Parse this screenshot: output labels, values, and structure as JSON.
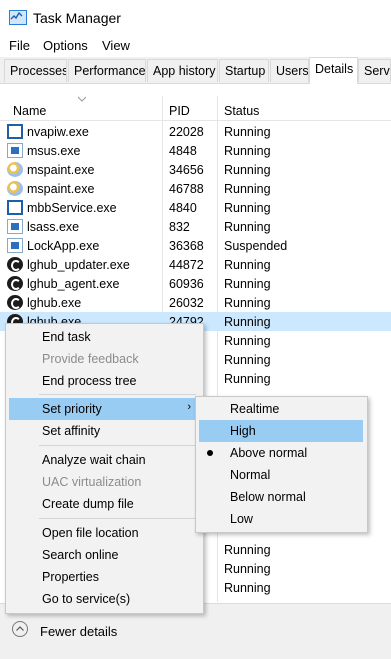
{
  "window": {
    "title": "Task Manager"
  },
  "menu": [
    "File",
    "Options",
    "View"
  ],
  "tabs": [
    "Processes",
    "Performance",
    "App history",
    "Startup",
    "Users",
    "Details",
    "Servic"
  ],
  "active_tab": "Details",
  "columns": {
    "name": "Name",
    "pid": "PID",
    "status": "Status"
  },
  "rows": [
    {
      "icon": "window-icon",
      "name": "nvapiw.exe",
      "pid": "22028",
      "status": "Running"
    },
    {
      "icon": "app-icon",
      "name": "msus.exe",
      "pid": "4848",
      "status": "Running"
    },
    {
      "icon": "paint-icon",
      "name": "mspaint.exe",
      "pid": "34656",
      "status": "Running"
    },
    {
      "icon": "paint-icon",
      "name": "mspaint.exe",
      "pid": "46788",
      "status": "Running"
    },
    {
      "icon": "window-icon",
      "name": "mbbService.exe",
      "pid": "4840",
      "status": "Running"
    },
    {
      "icon": "app-icon",
      "name": "lsass.exe",
      "pid": "832",
      "status": "Running"
    },
    {
      "icon": "app-icon",
      "name": "LockApp.exe",
      "pid": "36368",
      "status": "Suspended"
    },
    {
      "icon": "logitech-icon",
      "name": "lghub_updater.exe",
      "pid": "44872",
      "status": "Running"
    },
    {
      "icon": "logitech-icon",
      "name": "lghub_agent.exe",
      "pid": "60936",
      "status": "Running"
    },
    {
      "icon": "logitech-icon",
      "name": "lghub.exe",
      "pid": "26032",
      "status": "Running"
    },
    {
      "icon": "logitech-icon",
      "name": "lghub.exe",
      "pid": "24792",
      "status": "Running",
      "selected": true
    },
    {
      "status": "Running"
    },
    {
      "status": "Running"
    },
    {
      "status": "Running"
    },
    {
      "status": "Running"
    },
    {
      "status": "Running"
    },
    {
      "status": "Running"
    },
    {
      "status": "Running"
    }
  ],
  "context_menu": {
    "end_task": "End task",
    "provide_feedback": "Provide feedback",
    "end_process_tree": "End process tree",
    "set_priority": "Set priority",
    "set_affinity": "Set affinity",
    "analyze_wait_chain": "Analyze wait chain",
    "uac_virtualization": "UAC virtualization",
    "create_dump_file": "Create dump file",
    "open_file_location": "Open file location",
    "search_online": "Search online",
    "properties": "Properties",
    "go_to_services": "Go to service(s)"
  },
  "priority_submenu": {
    "items": [
      "Realtime",
      "High",
      "Above normal",
      "Normal",
      "Below normal",
      "Low"
    ],
    "highlighted": "High",
    "current": "Above normal"
  },
  "footer": {
    "fewer_details": "Fewer details"
  }
}
